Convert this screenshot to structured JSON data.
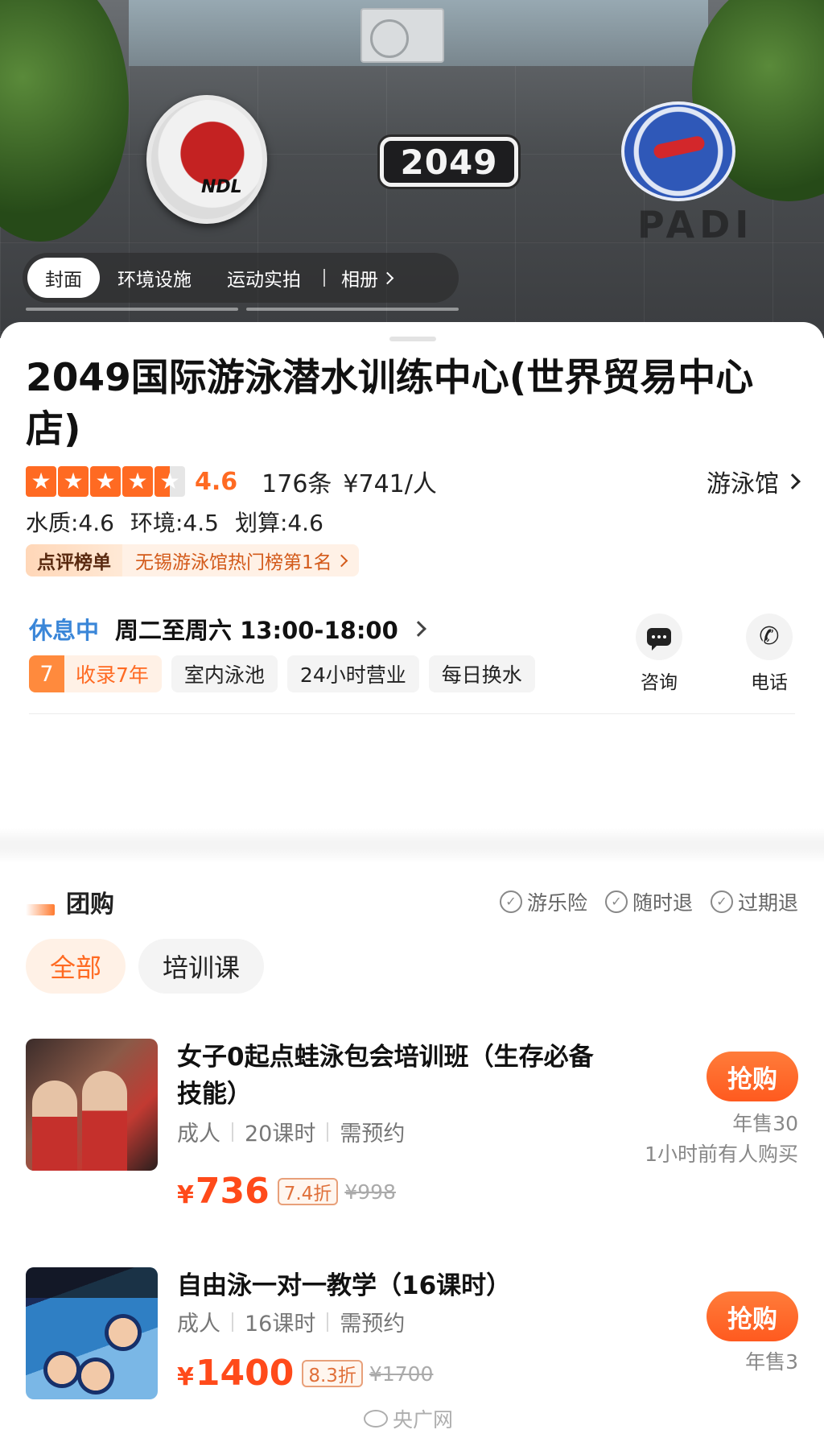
{
  "hero": {
    "plaque_text": "2049",
    "emblem_left_text": "NDL",
    "emblem_right_text": "PADI",
    "tabs": [
      {
        "label": "封面",
        "active": true
      },
      {
        "label": "环境设施",
        "active": false
      },
      {
        "label": "运动实拍",
        "active": false
      }
    ],
    "album_label": "相册"
  },
  "shop": {
    "title": "2049国际游泳潜水训练中心(世界贸易中心店)",
    "rating": "4.6",
    "reviews": "176条",
    "price_per_person": "¥741/人",
    "category": "游泳馆",
    "subscores": [
      "水质:4.6",
      "环境:4.5",
      "划算:4.6"
    ],
    "rank_badge_label": "点评榜单",
    "rank_badge_text": "无锡游泳馆热门榜第1名",
    "status": "休息中",
    "hours": "周二至周六 13:00-18:00",
    "years_num": "7",
    "years_label": "收录7年",
    "tags": [
      "室内泳池",
      "24小时营业",
      "每日换水"
    ],
    "actions": {
      "consult": "咨询",
      "phone": "电话"
    }
  },
  "group": {
    "title": "团购",
    "guarantees": [
      "游乐险",
      "随时退",
      "过期退"
    ],
    "filters": [
      "全部",
      "培训课"
    ],
    "deals": [
      {
        "title": "女子0起点蛙泳包会培训班（生存必备技能）",
        "specs": [
          "成人",
          "20课时",
          "需预约"
        ],
        "currency": "¥",
        "price": "736",
        "discount": "7.4折",
        "original": "¥998",
        "button": "抢购",
        "sold": "年售30",
        "recent": "1小时前有人购买"
      },
      {
        "title": "自由泳一对一教学（16课时）",
        "specs": [
          "成人",
          "16课时",
          "需预约"
        ],
        "currency": "¥",
        "price": "1400",
        "discount": "8.3折",
        "original": "¥1700",
        "button": "抢购",
        "sold": "年售3"
      }
    ]
  },
  "watermark": "央广网",
  "colors": {
    "accent": "#ff6a22",
    "price": "#ff4a1a",
    "status_blue": "#3a86d8"
  },
  "icons": [
    "star-icon",
    "chevron-right-icon",
    "chat-bubble-icon",
    "phone-icon",
    "check-circle-icon"
  ]
}
